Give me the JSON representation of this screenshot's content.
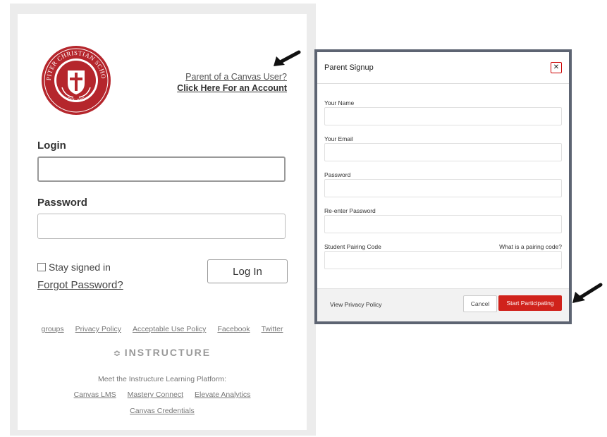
{
  "login_panel": {
    "logo": {
      "icon": "school-seal-icon",
      "top_text": "JUPITER CHRISTIAN SCHOOL",
      "bottom_text": "EST 1965",
      "color": "#b5262c"
    },
    "parent_link": {
      "line1": "Parent of a Canvas User?",
      "line2": "Click Here For an Account"
    },
    "login_label": "Login",
    "password_label": "Password",
    "stay_signed_in": "Stay signed in",
    "forgot_password": "Forgot Password?",
    "login_button": "Log In",
    "footer_links": [
      "groups",
      "Privacy Policy",
      "Acceptable Use Policy",
      "Facebook",
      "Twitter"
    ],
    "instructure_logo": "INSTRUCTURE",
    "meet_text": "Meet the Instructure Learning Platform:",
    "platform_links": [
      "Canvas LMS",
      "Mastery Connect",
      "Elevate Analytics"
    ],
    "credentials_link": "Canvas Credentials"
  },
  "modal": {
    "title": "Parent Signup",
    "close_icon": "close-icon",
    "fields": [
      {
        "label": "Your Name",
        "value": ""
      },
      {
        "label": "Your Email",
        "value": ""
      },
      {
        "label": "Password",
        "value": ""
      },
      {
        "label": "Re-enter Password",
        "value": ""
      },
      {
        "label": "Student Pairing Code",
        "value": ""
      }
    ],
    "pairing_help": "What is a pairing code?",
    "privacy_link": "View Privacy Policy",
    "cancel_button": "Cancel",
    "start_button": "Start Participating",
    "accent_color": "#d0221b"
  },
  "annotations": {
    "arrow_icon": "pointer-arrow-icon"
  }
}
